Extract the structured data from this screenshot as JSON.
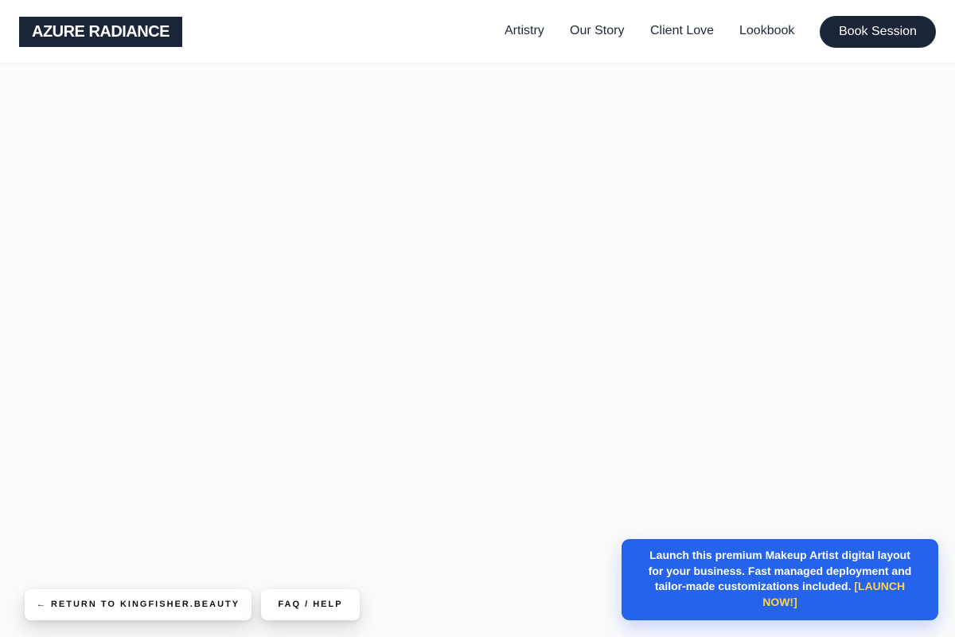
{
  "header": {
    "logo": "AZURE RADIANCE",
    "nav": {
      "artistry": "Artistry",
      "our_story": "Our Story",
      "client_love": "Client Love",
      "lookbook": "Lookbook"
    },
    "book_label": "Book Session"
  },
  "footer_buttons": {
    "return_label": "← RETURN TO KINGFISHER.BEAUTY",
    "faq_label": "FAQ / HELP"
  },
  "promo": {
    "text": "Launch this premium Makeup Artist digital layout for your business. Fast managed deployment and tailor-made customizations included. ",
    "link_label": "[LAUNCH NOW!]"
  },
  "colors": {
    "brand_dark": "#1b2538",
    "promo_blue": "#2563eb",
    "promo_link": "#fcd34d",
    "page_bg": "#fbfbfb"
  }
}
